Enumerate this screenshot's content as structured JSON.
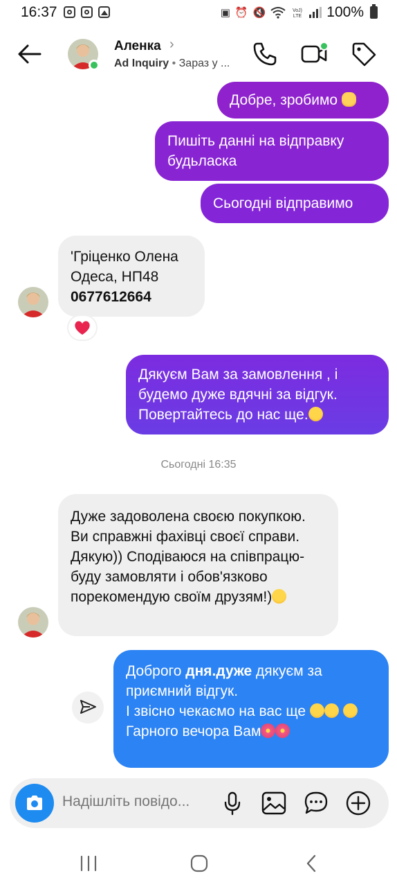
{
  "status_bar": {
    "time": "16:37",
    "battery": "100%",
    "left_icons": [
      "instagram-icon",
      "instagram-icon",
      "gallery-icon"
    ],
    "right_icons": [
      "battery-saver-icon",
      "alarm-icon",
      "mute-icon",
      "wifi-icon",
      "volte-icon",
      "signal-icon",
      "battery-icon"
    ]
  },
  "header": {
    "name": "Аленка",
    "source": "Ad Inquiry",
    "separator": "•",
    "status": "Зараз у ...",
    "online": true
  },
  "messages": {
    "m1": {
      "text": "Добре, зробимо",
      "emoji": "ok-hand"
    },
    "m2": {
      "text": "Пишіть данні на відправку будьласка"
    },
    "m3": {
      "text": "Сьогодні відправимо"
    },
    "m4": {
      "line1": "'Гріценко Олена",
      "line2": "Одеса, НП48",
      "phone": "0677612664",
      "reaction": "heart"
    },
    "m5": {
      "text": "Дякуєм Вам  за замовлення , і будемо дуже вдячні за відгук. Повертайтесь до нас ще.",
      "emoji": "hugging-face"
    },
    "timestamp": "Сьогодні 16:35",
    "m6": {
      "text": "Дуже задоволена своєю покупкою. Ви справжні фахівці своєї справи. Дякую)) Сподіваюся на співпрацю- буду замовляти і обов'язково порекомендую своїм друзям!)",
      "emoji": "hugging-face"
    },
    "m7": {
      "part1": "Доброго ",
      "bold": "дня.дуже",
      "part2": " дякуєм за приємний відгук.",
      "line2": "І звісно чекаємо на вас ще ",
      "line3": "Гарного вечора Вам",
      "emojis": [
        "hugging-face",
        "hibiscus"
      ]
    }
  },
  "composer": {
    "placeholder": "Надішліть повідо..."
  },
  "colors": {
    "accent_purple": "#8f22cd",
    "accent_blue": "#2c83f4",
    "incoming_bubble": "#efefef",
    "online_green": "#39c15e"
  }
}
